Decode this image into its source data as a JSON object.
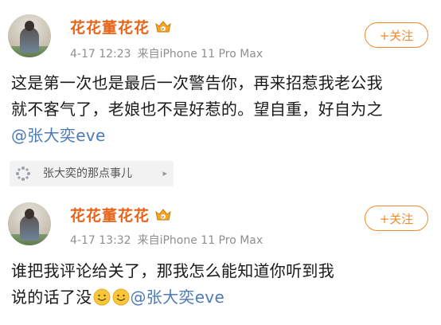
{
  "posts": [
    {
      "username": "花花董花花",
      "time": "4-17 12:23",
      "source": "来自iPhone 11 Pro Max",
      "follow_label": "+关注",
      "text_lines": [
        "这是第一次也是最后一次警告你，再来招惹我老公我",
        "就不客气了，老娘也不是好惹的。望自重，好自为之"
      ],
      "mention": "@张大奕eve"
    },
    {
      "username": "花花董花花",
      "time": "4-17 13:32",
      "source": "来自iPhone 11 Pro Max",
      "follow_label": "+关注",
      "text_lines": [
        "谁把我评论给关了，那我怎么能知道你听到我",
        "说的话了没"
      ],
      "mention": "@张大奕eve"
    }
  ],
  "topic_chip": {
    "label": "张大奕的那点事儿",
    "arrow": "▸"
  },
  "icons": {
    "vip_badge": "vip-crown-badge-icon",
    "emoji": "smile-emoji-icon",
    "topic": "topic-sparkle-icon"
  },
  "colors": {
    "username": "#e86316",
    "follow": "#f28a2c",
    "mention": "#4d7bb5",
    "meta": "#8f8f8f"
  }
}
